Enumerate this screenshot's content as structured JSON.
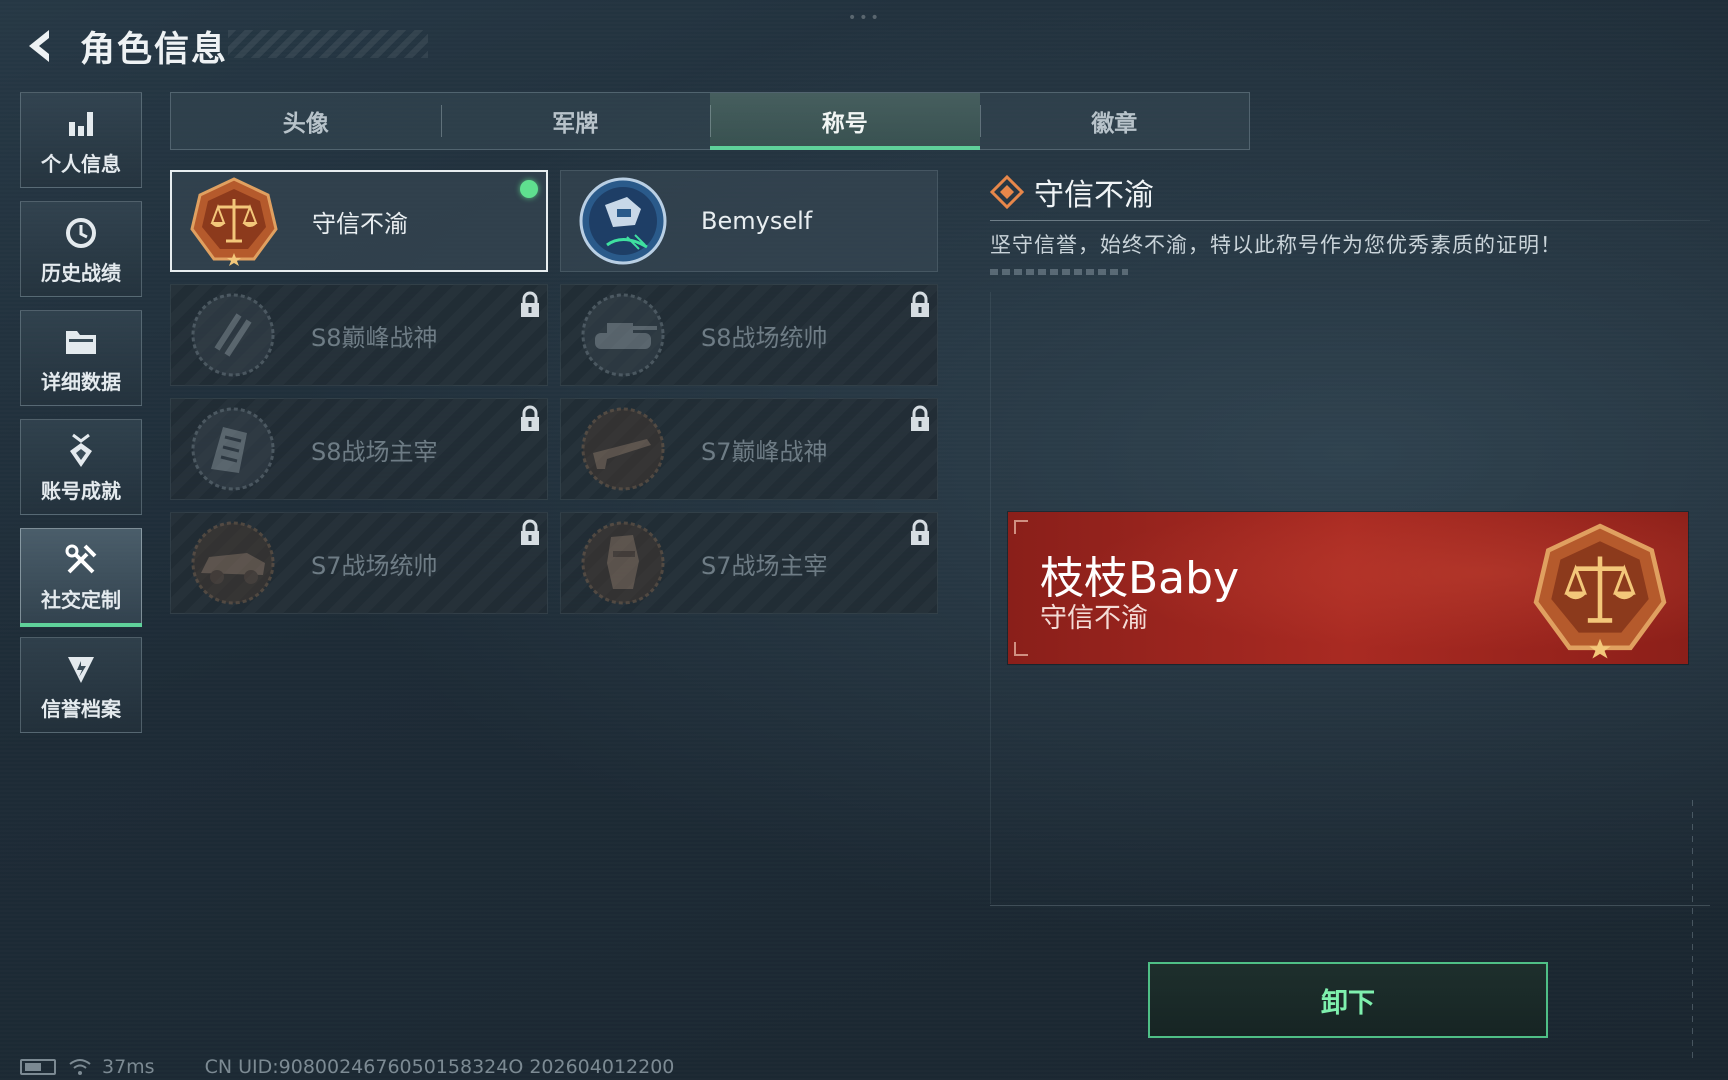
{
  "header": {
    "title": "角色信息"
  },
  "sidebar": {
    "items": [
      {
        "label": "个人信息",
        "icon": "bar-chart-icon"
      },
      {
        "label": "历史战绩",
        "icon": "clock-icon"
      },
      {
        "label": "详细数据",
        "icon": "folder-icon"
      },
      {
        "label": "账号成就",
        "icon": "medal-icon"
      },
      {
        "label": "社交定制",
        "icon": "tools-icon",
        "active": true
      },
      {
        "label": "信誉档案",
        "icon": "shield-icon"
      }
    ]
  },
  "tabs": [
    {
      "label": "头像"
    },
    {
      "label": "军牌"
    },
    {
      "label": "称号",
      "active": true
    },
    {
      "label": "徽章"
    }
  ],
  "titles": [
    {
      "name": "守信不渝",
      "locked": false,
      "selected": true,
      "equipped": true
    },
    {
      "name": "Bemyself",
      "locked": false,
      "selected": false
    },
    {
      "name": "S8巅峰战神",
      "locked": true
    },
    {
      "name": "S8战场统帅",
      "locked": true
    },
    {
      "name": "S8战场主宰",
      "locked": true
    },
    {
      "name": "S7巅峰战神",
      "locked": true
    },
    {
      "name": "S7战场统帅",
      "locked": true
    },
    {
      "name": "S7战场主宰",
      "locked": true
    }
  ],
  "detail": {
    "title": "守信不渝",
    "description": "坚守信誉，始终不渝，特以此称号作为您优秀素质的证明！"
  },
  "nameplate": {
    "player_name": "枝枝Baby",
    "title": "守信不渝"
  },
  "unequip_button": {
    "label": "卸下"
  },
  "status_bar": {
    "ping": "37ms",
    "uid": "CN UID:9080024676050158324O 202604012200"
  },
  "colors": {
    "accent_green": "#5fd19a",
    "plate_red": "#a92a22",
    "emblem_orange": "#c4622a",
    "gold": "#e7b45a"
  }
}
